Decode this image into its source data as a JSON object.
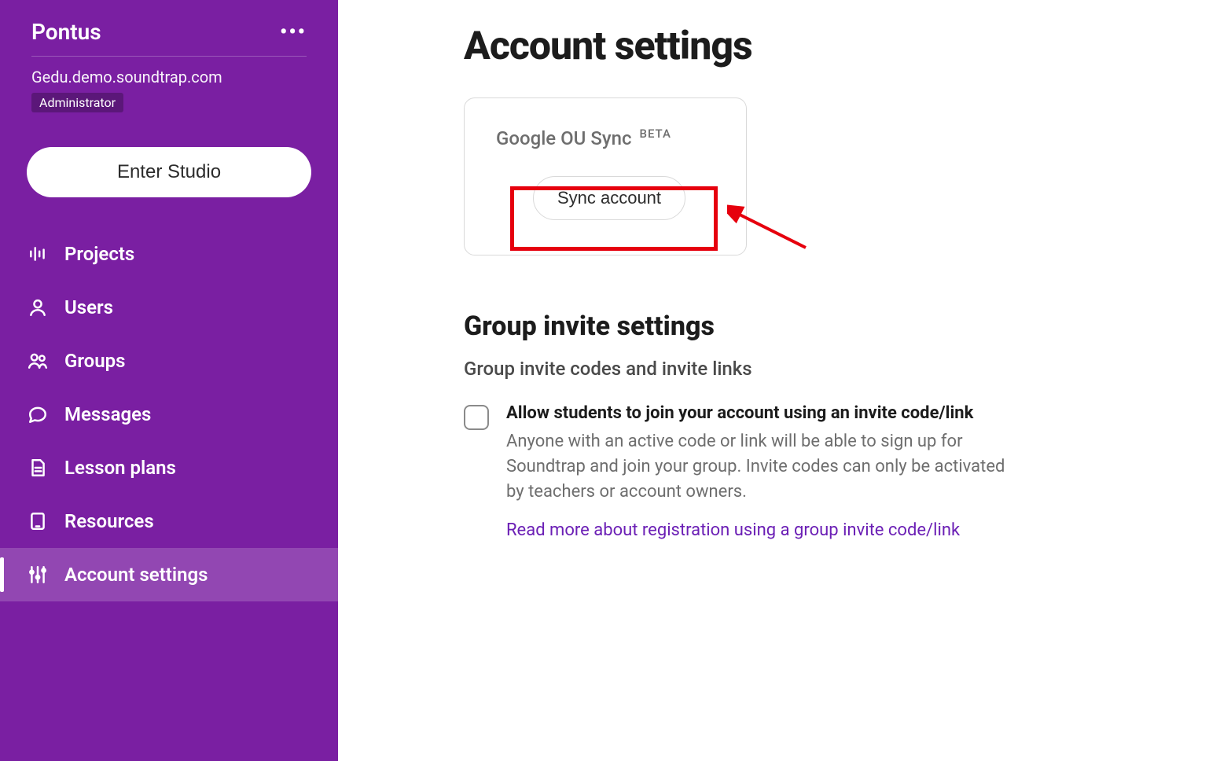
{
  "sidebar": {
    "title": "Pontus",
    "domain": "Gedu.demo.soundtrap.com",
    "role_label": "Administrator",
    "enter_studio_label": "Enter Studio",
    "nav": [
      {
        "id": "projects",
        "label": "Projects",
        "icon": "audio-levels-icon",
        "active": false
      },
      {
        "id": "users",
        "label": "Users",
        "icon": "user-icon",
        "active": false
      },
      {
        "id": "groups",
        "label": "Groups",
        "icon": "users-icon",
        "active": false
      },
      {
        "id": "messages",
        "label": "Messages",
        "icon": "chat-icon",
        "active": false
      },
      {
        "id": "lesson-plans",
        "label": "Lesson plans",
        "icon": "document-icon",
        "active": false
      },
      {
        "id": "resources",
        "label": "Resources",
        "icon": "tablet-icon",
        "active": false
      },
      {
        "id": "account-settings",
        "label": "Account settings",
        "icon": "sliders-icon",
        "active": true
      }
    ]
  },
  "main": {
    "page_title": "Account settings",
    "sync_card": {
      "title": "Google OU Sync",
      "badge": "BETA",
      "button_label": "Sync account"
    },
    "group_invite": {
      "section_heading": "Group invite settings",
      "sub_heading": "Group invite codes and invite links",
      "checkbox_label": "Allow students to join your account using an invite code/link",
      "checkbox_desc": "Anyone with an active code or link will be able to sign up for Soundtrap and join your group. Invite codes can only be activated by teachers or account owners.",
      "read_more": "Read more about registration using a group invite code/link"
    }
  },
  "colors": {
    "sidebar_bg": "#7a1fa2",
    "link": "#6b1fb5",
    "annotation": "#e6000d"
  }
}
